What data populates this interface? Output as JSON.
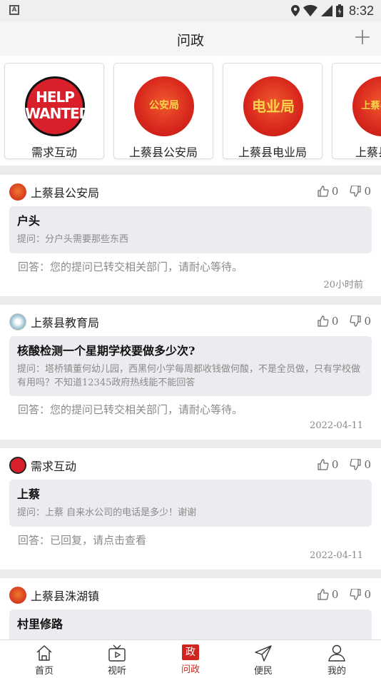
{
  "status_bar": {
    "time": "8:32",
    "notification_badge": "A"
  },
  "header": {
    "title": "问政"
  },
  "departments": [
    {
      "label": "需求互动",
      "logo_text": [
        "HELP",
        "WANTED"
      ]
    },
    {
      "label": "上蔡县公安局",
      "logo_text": "公安局"
    },
    {
      "label": "上蔡县电业局",
      "logo_text": "电业局"
    },
    {
      "label": "上蔡县",
      "logo_text": "上蔡县"
    }
  ],
  "posts": [
    {
      "org": "上蔡县公安局",
      "likes": "0",
      "dislikes": "0",
      "title": "户头",
      "question": "提问：分户头需要那些东西",
      "answer": "回答：您的提问已转交相关部门，请耐心等待。",
      "time": "20小时前"
    },
    {
      "org": "上蔡县教育局",
      "likes": "0",
      "dislikes": "0",
      "title": "核酸检测一个星期学校要做多少次?",
      "question": "提问：塔桥镇董何幼儿园，西黑何小学每周都收钱做何酸，不是全员做，只有学校做有用吗？不知道12345政府热线能不能回答",
      "answer": "回答：您的提问已转交相关部门，请耐心等待。",
      "time": "2022-04-11"
    },
    {
      "org": "需求互动",
      "likes": "0",
      "dislikes": "0",
      "title": "上蔡",
      "question": "提问：上蔡 自来水公司的电话是多少！谢谢",
      "answer": "回答：已回复，请点击查看",
      "time": "2022-04-11"
    },
    {
      "org": "上蔡县洙湖镇",
      "likes": "0",
      "dislikes": "0",
      "title": "村里修路"
    }
  ],
  "tabbar": {
    "items": [
      {
        "label": "首页",
        "icon": "home-icon"
      },
      {
        "label": "视听",
        "icon": "tv-icon"
      },
      {
        "label": "问政",
        "icon": "zheng-icon",
        "icon_text": "政",
        "active": true
      },
      {
        "label": "便民",
        "icon": "send-icon"
      },
      {
        "label": "我的",
        "icon": "user-icon"
      }
    ]
  },
  "colors": {
    "accent": "#d0241e",
    "background": "#f3f3f3",
    "question_box": "#ebecef"
  }
}
